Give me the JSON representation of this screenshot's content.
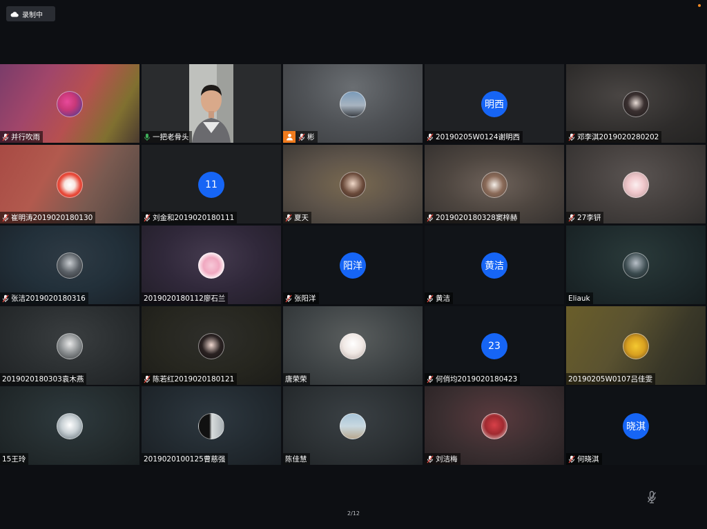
{
  "recording": {
    "label": "录制中",
    "icon": "cloud-icon"
  },
  "colors": {
    "accent_blue": "#1665f5",
    "active_border": "#3fae5a",
    "host_orange": "#f07b1e",
    "mic_red": "#e0453c",
    "mic_green": "#3fae5a"
  },
  "page_indicator": "2/12",
  "participants": [
    {
      "name": "并行吹雨",
      "avatar_text": "",
      "mic": "muted"
    },
    {
      "name": "一把老骨头",
      "avatar_text": "",
      "mic": "active",
      "video": true
    },
    {
      "name": "彬",
      "avatar_text": "",
      "mic": "muted",
      "host": true
    },
    {
      "name": "20190205W0124谢明西",
      "avatar_text": "明西",
      "mic": "muted"
    },
    {
      "name": "邓李淇2019020280202",
      "avatar_text": "",
      "mic": "muted"
    },
    {
      "name": "崔明涛2019020180130",
      "avatar_text": "",
      "mic": "muted"
    },
    {
      "name": "刘金和2019020180111",
      "avatar_text": "11",
      "mic": "muted"
    },
    {
      "name": "夏天",
      "avatar_text": "",
      "mic": "muted"
    },
    {
      "name": "2019020180328窦梓赫",
      "avatar_text": "",
      "mic": "muted"
    },
    {
      "name": "27李钘",
      "avatar_text": "",
      "mic": "muted"
    },
    {
      "name": "张洁2019020180316",
      "avatar_text": "",
      "mic": "muted"
    },
    {
      "name": "2019020180112廖石兰",
      "avatar_text": "",
      "mic": "none"
    },
    {
      "name": "张阳洋",
      "avatar_text": "阳洋",
      "mic": "muted"
    },
    {
      "name": "黄洁",
      "avatar_text": "黄洁",
      "mic": "muted"
    },
    {
      "name": "Eliauk",
      "avatar_text": "",
      "mic": "none"
    },
    {
      "name": "2019020180303袁木燕",
      "avatar_text": "",
      "mic": "none"
    },
    {
      "name": "陈若红2019020180121",
      "avatar_text": "",
      "mic": "muted"
    },
    {
      "name": "唐荣荣",
      "avatar_text": "",
      "mic": "none"
    },
    {
      "name": "何俏均2019020180423",
      "avatar_text": "23",
      "mic": "muted"
    },
    {
      "name": "20190205W0107吕佳雯",
      "avatar_text": "",
      "mic": "none"
    },
    {
      "name": "15王玲",
      "avatar_text": "",
      "mic": "none"
    },
    {
      "name": "2019020100125曹慈强",
      "avatar_text": "",
      "mic": "none"
    },
    {
      "name": "陈佳慧",
      "avatar_text": "",
      "mic": "none"
    },
    {
      "name": "刘洁梅",
      "avatar_text": "",
      "mic": "muted"
    },
    {
      "name": "何晓淇",
      "avatar_text": "晓淇",
      "mic": "muted"
    }
  ]
}
